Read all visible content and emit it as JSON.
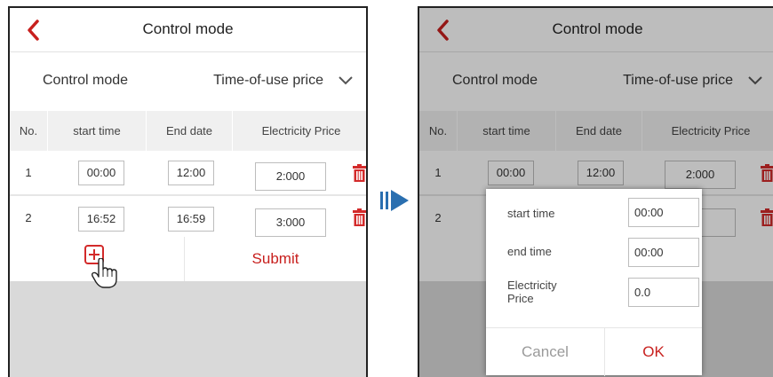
{
  "colors": {
    "accent": "#c8201e",
    "arrow": "#2a6fb0"
  },
  "left": {
    "title": "Control mode",
    "mode_label": "Control mode",
    "mode_value": "Time-of-use price",
    "headers": [
      "No.",
      "start time",
      "End date",
      "Electricity Price"
    ],
    "rows": [
      {
        "no": "1",
        "start": "00:00",
        "end": "12:00",
        "price": "2:000"
      },
      {
        "no": "2",
        "start": "16:52",
        "end": "16:59",
        "price": "3:000"
      }
    ],
    "submit_label": "Submit"
  },
  "right": {
    "title": "Control mode",
    "mode_label": "Control mode",
    "mode_value": "Time-of-use price",
    "headers": [
      "No.",
      "start time",
      "End date",
      "Electricity Price"
    ],
    "rows": [
      {
        "no": "1",
        "start": "00:00",
        "end": "12:00",
        "price": "2:000"
      },
      {
        "no": "2"
      }
    ],
    "dialog": {
      "start_label": "start time",
      "start_value": "00:00",
      "end_label": "end time",
      "end_value": "00:00",
      "price_label": "Electricity Price",
      "price_value": "0.0",
      "cancel_label": "Cancel",
      "ok_label": "OK"
    }
  }
}
